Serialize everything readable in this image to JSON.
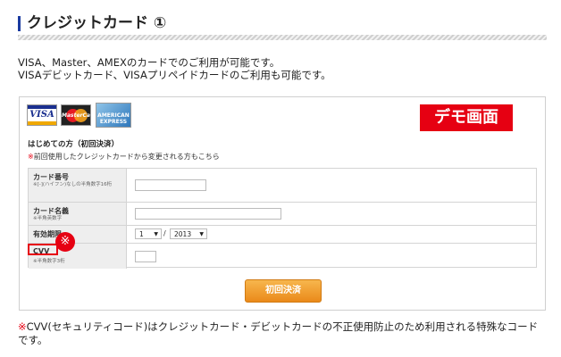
{
  "heading": {
    "title": "クレジットカード ①"
  },
  "intro": {
    "line1": "VISA、Master、AMEXのカードでのご利用が可能です。",
    "line2": "VISAデビットカード、VISAプリペイドカードのご利用も可能です。"
  },
  "cards": {
    "visa": "VISA",
    "master": "MasterCard",
    "amex": "AMERICAN EXPRESS"
  },
  "demo_label": "デモ画面",
  "form": {
    "first_title": "はじめての方（初回決済）",
    "prev_note_mark": "※",
    "prev_note": "前回使用したクレジットカードから変更される方もこちら",
    "card_number": {
      "label": "カード番号",
      "hint": "※[-](ハイフン)なしの半角数字16桁",
      "value": ""
    },
    "card_name": {
      "label": "カード名義",
      "hint": "※半角英数字",
      "value": ""
    },
    "expiry": {
      "label": "有効期限",
      "month": "1",
      "separator": "/",
      "year": "2013"
    },
    "cvv": {
      "label": "CVV",
      "hint": "※半角数字3桁",
      "value": ""
    },
    "submit_label": "初回決済"
  },
  "cvv_badge_mark": "※",
  "footnote": {
    "mark": "※",
    "text": "CVV(セキュリティコード)はクレジットカード・デビットカードの不正使用防止のため利用される特殊なコードです。"
  },
  "colors": {
    "accent_red": "#e60012",
    "heading_bar": "#1a3aa0",
    "button_orange": "#ea8a1a"
  }
}
